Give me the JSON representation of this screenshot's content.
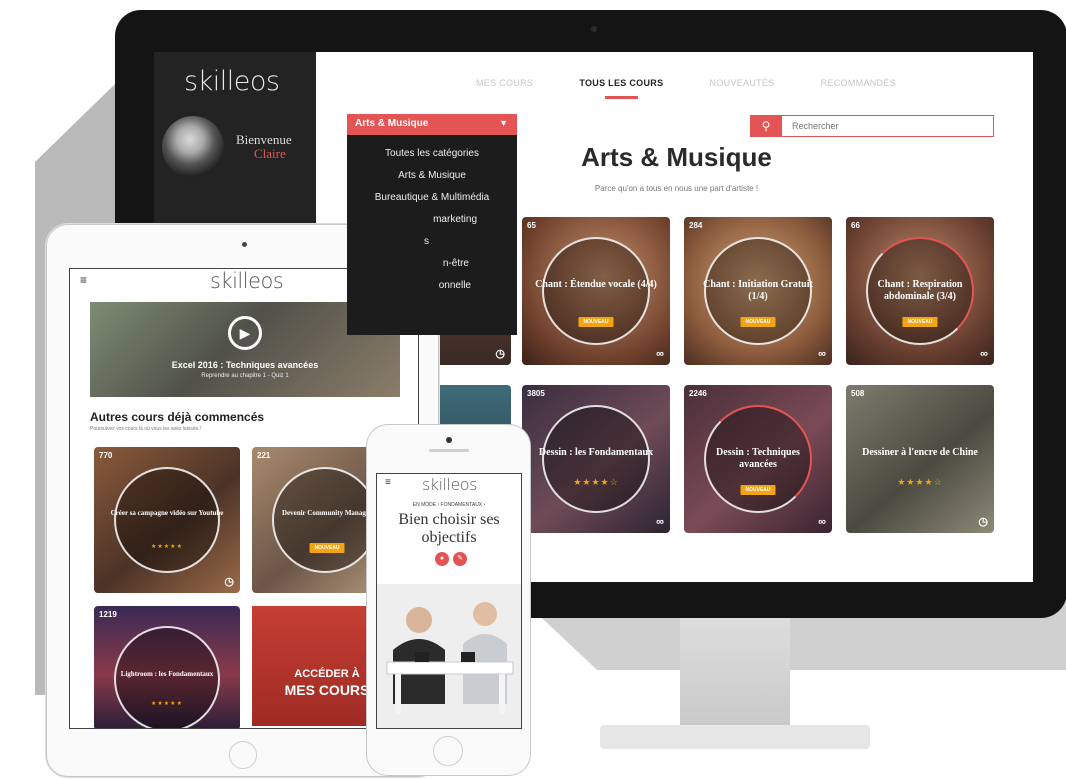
{
  "desktop": {
    "brand": "skilleos",
    "sidebar": {
      "welcome": "Bienvenue",
      "user_name": "Claire"
    },
    "nav_tabs": [
      {
        "label": "MES COURS",
        "active": false
      },
      {
        "label": "TOUS LES COURS",
        "active": true
      },
      {
        "label": "NOUVEAUTÉS",
        "active": false
      },
      {
        "label": "RECOMMANDÉS",
        "active": false
      }
    ],
    "category_dropdown": {
      "selected": "Arts & Musique",
      "options": [
        "Toutes les catégories",
        "Arts & Musique",
        "Bureautique & Multimédia",
        "marketing",
        "s",
        "n-être",
        "onnelle"
      ]
    },
    "search": {
      "placeholder": "Rechercher",
      "icon": "search-icon"
    },
    "page_title": "Arts & Musique",
    "page_subtitle": "Parce qu'on a tous en nous une part d'artiste !",
    "courses": [
      {
        "count": "65",
        "title": "Chant : Étendue vocale (4/4)",
        "badge": "NOUVEAU",
        "stars": "",
        "icon": "infinity-icon"
      },
      {
        "count": "284",
        "title": "Chant : Initiation Gratuit (1/4)",
        "badge": "NOUVEAU",
        "stars": "",
        "icon": "infinity-icon"
      },
      {
        "count": "66",
        "title": "Chant : Respiration abdominale (3/4)",
        "badge": "NOUVEAU",
        "stars": "",
        "icon": "infinity-icon"
      },
      {
        "count": "3805",
        "title": "Dessin : les Fondamentaux",
        "badge": "",
        "stars": "★★★★☆",
        "icon": "infinity-icon"
      },
      {
        "count": "2246",
        "title": "Dessin : Techniques avancées",
        "badge": "NOUVEAU",
        "stars": "",
        "icon": "infinity-icon"
      },
      {
        "count": "508",
        "title": "Dessiner à l'encre de Chine",
        "badge": "",
        "stars": "★★★★☆",
        "icon": "clock-icon"
      }
    ],
    "accent_color": "#e55454",
    "badge_color": "#f2a413"
  },
  "tablet": {
    "brand": "skilleos",
    "hero": {
      "title": "Excel 2016 : Techniques avancées",
      "subtitle": "Reprendre au chapitre 1 - Quiz 1"
    },
    "section_title": "Autres cours déjà commencés",
    "section_subtitle": "Poursuivez vos cours là où vous les avez laissés !",
    "courses": [
      {
        "count": "770",
        "title": "Créer sa campagne vidéo sur Youtube",
        "badge": "",
        "stars": "★★★★★"
      },
      {
        "count": "221",
        "title": "Devenir Community Manager",
        "badge": "NOUVEAU",
        "stars": ""
      },
      {
        "count": "1219",
        "title": "Lightroom : les Fondamentaux",
        "badge": "",
        "stars": "★★★★★"
      }
    ],
    "cta": {
      "line1": "ACCÉDER À",
      "line2": "MES COURS"
    }
  },
  "phone": {
    "brand": "skilleos",
    "breadcrumb": "EN MODE › FONDAMENTAUX ›",
    "title_line1": "Bien choisir ses",
    "title_line2": "objectifs"
  }
}
